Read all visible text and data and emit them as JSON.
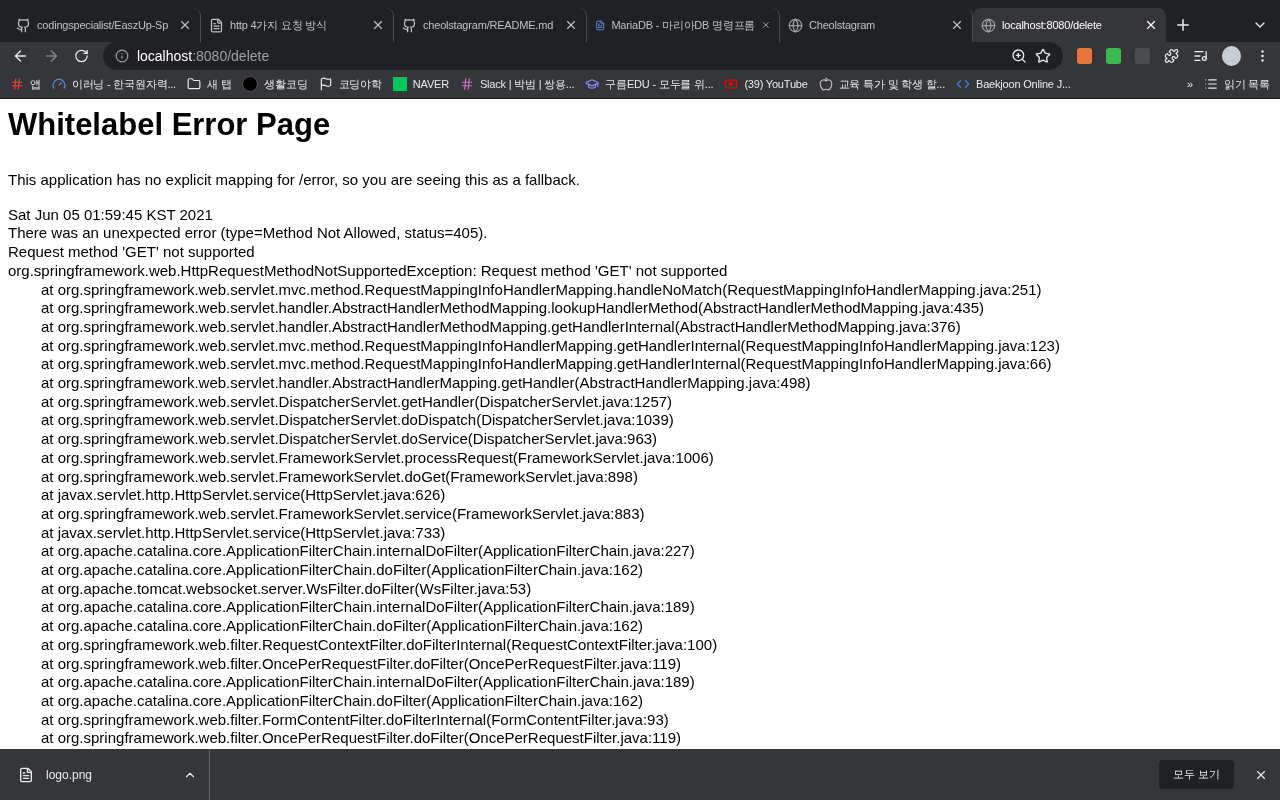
{
  "tabs": [
    {
      "title": "codingspecialist/EaszUp-Sp",
      "selected": false
    },
    {
      "title": "http 4가지 요청 방식",
      "selected": false
    },
    {
      "title": "cheolstagram/README.md",
      "selected": false
    },
    {
      "title": "MariaDB - 마리아DB 명령프롬",
      "selected": false
    },
    {
      "title": "Cheolstagram",
      "selected": false
    },
    {
      "title": "localhost:8080/delete",
      "selected": true
    }
  ],
  "address": {
    "host": "localhost",
    "path": ":8080/delete"
  },
  "bookmarks": [
    "앱",
    "이러닝 - 한국원자력...",
    "새 탭",
    "생활코딩",
    "코딩야학",
    "NAVER",
    "Slack | 박범 | 쌍용...",
    "구름EDU - 모두를 위...",
    "(39) YouTube",
    "교육 특가 및 학생 할...",
    "Baekjoon Online J..."
  ],
  "overflow": "»",
  "reading_list": "읽기 목록",
  "page": {
    "heading": "Whitelabel Error Page",
    "intro": "This application has no explicit mapping for /error, so you are seeing this as a fallback.",
    "lines": [
      "Sat Jun 05 01:59:45 KST 2021",
      "There was an unexpected error (type=Method Not Allowed, status=405).",
      "Request method 'GET' not supported",
      "org.springframework.web.HttpRequestMethodNotSupportedException: Request method 'GET' not supported"
    ],
    "trace": [
      "at org.springframework.web.servlet.mvc.method.RequestMappingInfoHandlerMapping.handleNoMatch(RequestMappingInfoHandlerMapping.java:251)",
      "at org.springframework.web.servlet.handler.AbstractHandlerMethodMapping.lookupHandlerMethod(AbstractHandlerMethodMapping.java:435)",
      "at org.springframework.web.servlet.handler.AbstractHandlerMethodMapping.getHandlerInternal(AbstractHandlerMethodMapping.java:376)",
      "at org.springframework.web.servlet.mvc.method.RequestMappingInfoHandlerMapping.getHandlerInternal(RequestMappingInfoHandlerMapping.java:123)",
      "at org.springframework.web.servlet.mvc.method.RequestMappingInfoHandlerMapping.getHandlerInternal(RequestMappingInfoHandlerMapping.java:66)",
      "at org.springframework.web.servlet.handler.AbstractHandlerMapping.getHandler(AbstractHandlerMapping.java:498)",
      "at org.springframework.web.servlet.DispatcherServlet.getHandler(DispatcherServlet.java:1257)",
      "at org.springframework.web.servlet.DispatcherServlet.doDispatch(DispatcherServlet.java:1039)",
      "at org.springframework.web.servlet.DispatcherServlet.doService(DispatcherServlet.java:963)",
      "at org.springframework.web.servlet.FrameworkServlet.processRequest(FrameworkServlet.java:1006)",
      "at org.springframework.web.servlet.FrameworkServlet.doGet(FrameworkServlet.java:898)",
      "at javax.servlet.http.HttpServlet.service(HttpServlet.java:626)",
      "at org.springframework.web.servlet.FrameworkServlet.service(FrameworkServlet.java:883)",
      "at javax.servlet.http.HttpServlet.service(HttpServlet.java:733)",
      "at org.apache.catalina.core.ApplicationFilterChain.internalDoFilter(ApplicationFilterChain.java:227)",
      "at org.apache.catalina.core.ApplicationFilterChain.doFilter(ApplicationFilterChain.java:162)",
      "at org.apache.tomcat.websocket.server.WsFilter.doFilter(WsFilter.java:53)",
      "at org.apache.catalina.core.ApplicationFilterChain.internalDoFilter(ApplicationFilterChain.java:189)",
      "at org.apache.catalina.core.ApplicationFilterChain.doFilter(ApplicationFilterChain.java:162)",
      "at org.springframework.web.filter.RequestContextFilter.doFilterInternal(RequestContextFilter.java:100)",
      "at org.springframework.web.filter.OncePerRequestFilter.doFilter(OncePerRequestFilter.java:119)",
      "at org.apache.catalina.core.ApplicationFilterChain.internalDoFilter(ApplicationFilterChain.java:189)",
      "at org.apache.catalina.core.ApplicationFilterChain.doFilter(ApplicationFilterChain.java:162)",
      "at org.springframework.web.filter.FormContentFilter.doFilterInternal(FormContentFilter.java:93)",
      "at org.springframework.web.filter.OncePerRequestFilter.doFilter(OncePerRequestFilter.java:119)"
    ]
  },
  "downloads": {
    "file": "logo.png",
    "show_all": "모두 보기"
  }
}
